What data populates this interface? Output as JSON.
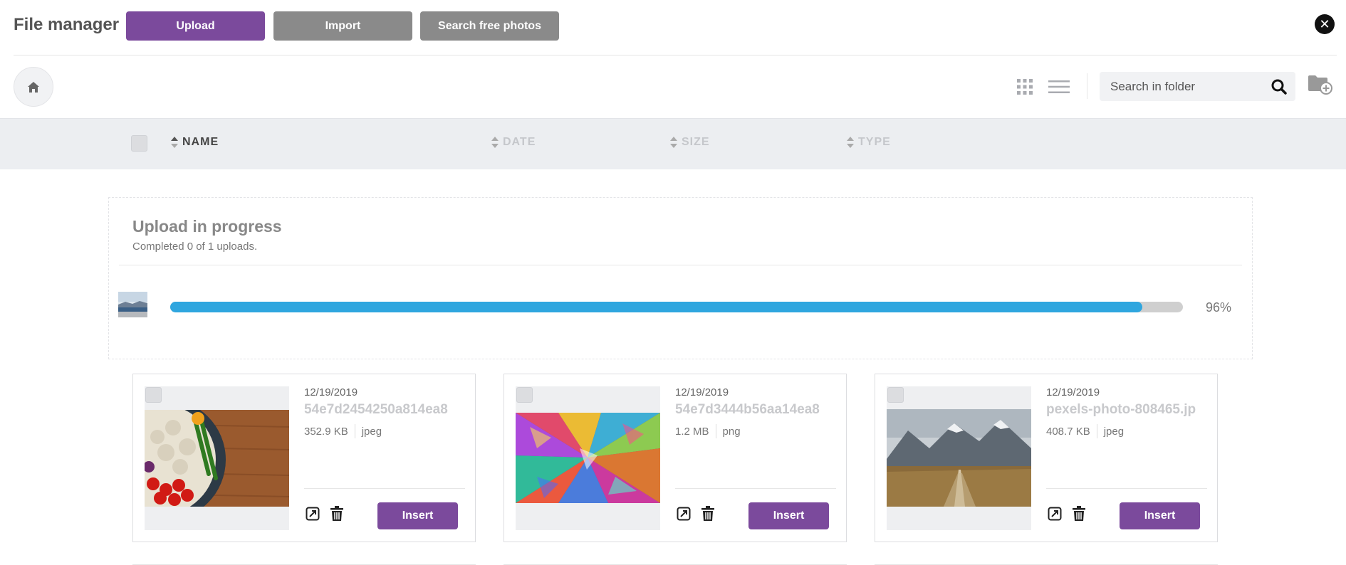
{
  "header": {
    "title": "File manager",
    "upload_label": "Upload",
    "import_label": "Import",
    "search_photos_label": "Search free photos",
    "accent_color": "#7b4a9c"
  },
  "toolbar": {
    "search_placeholder": "Search in folder"
  },
  "columns": {
    "name": "NAME",
    "date": "DATE",
    "size": "SIZE",
    "type": "TYPE"
  },
  "upload": {
    "title": "Upload in progress",
    "subtitle": "Completed 0 of 1 uploads.",
    "progress_label": "96%",
    "progress": 0.96,
    "progress_color": "#2fa6df"
  },
  "files": [
    {
      "date": "12/19/2019",
      "name": "54e7d2454250a814ea8",
      "size": "352.9 KB",
      "type": "jpeg",
      "insert_label": "Insert",
      "thumbnail": "vegetables-on-wood"
    },
    {
      "date": "12/19/2019",
      "name": "54e7d3444b56aa14ea8",
      "size": "1.2 MB",
      "type": "png",
      "insert_label": "Insert",
      "thumbnail": "colorful-abstract"
    },
    {
      "date": "12/19/2019",
      "name": "pexels-photo-808465.jp",
      "size": "408.7 KB",
      "type": "jpeg",
      "insert_label": "Insert",
      "thumbnail": "mountain-boardwalk"
    }
  ]
}
